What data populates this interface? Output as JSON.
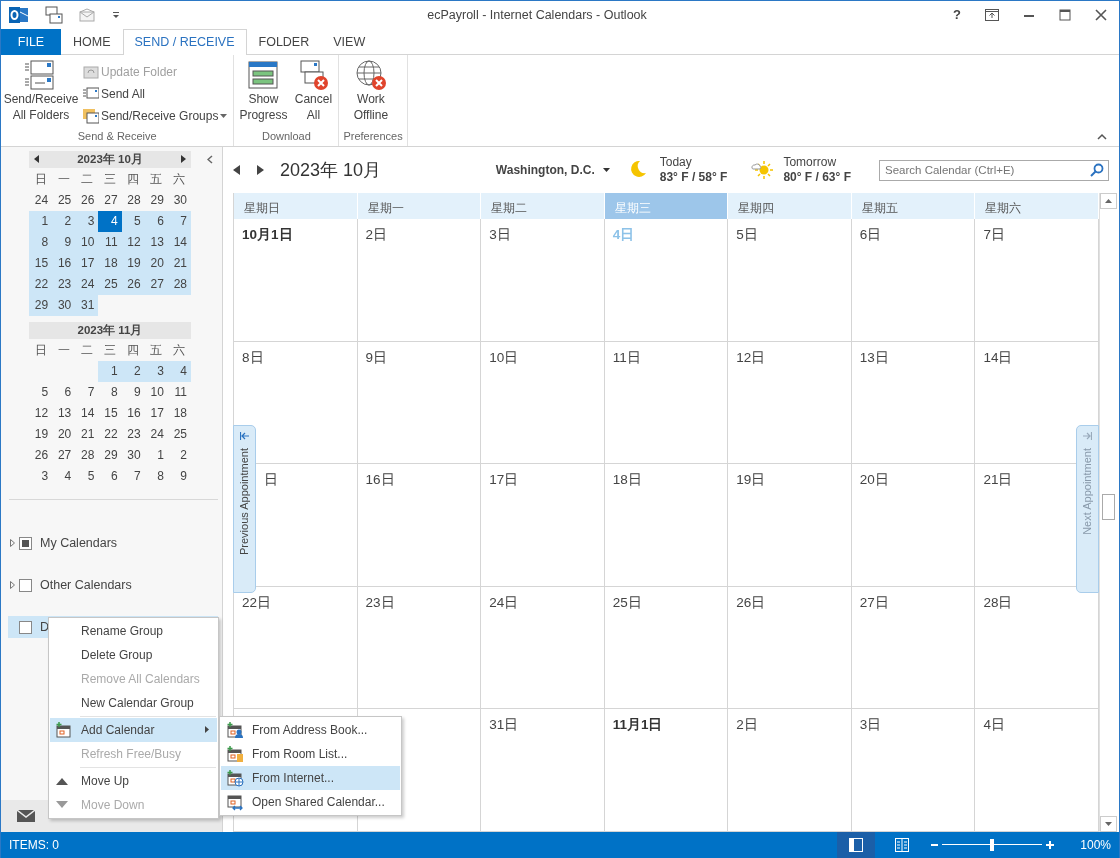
{
  "title_bar": {
    "title": "ecPayroll - Internet Calendars - Outlook",
    "help": "?"
  },
  "ribbon_tabs": [
    {
      "label": "FILE",
      "kind": "file",
      "selected": false
    },
    {
      "label": "HOME",
      "kind": "tab",
      "selected": false
    },
    {
      "label": "SEND / RECEIVE",
      "kind": "tab",
      "selected": true
    },
    {
      "label": "FOLDER",
      "kind": "tab",
      "selected": false
    },
    {
      "label": "VIEW",
      "kind": "tab",
      "selected": false
    }
  ],
  "ribbon_groups": [
    {
      "name": "Send & Receive",
      "buttons": [
        {
          "label": "Send/Receive All Folders",
          "kind": "large",
          "disabled": false
        },
        {
          "label": "Update Folder",
          "kind": "small",
          "disabled": true
        },
        {
          "label": "Send All",
          "kind": "small",
          "disabled": false
        },
        {
          "label": "Send/Receive Groups",
          "kind": "small-dropdown",
          "disabled": false
        }
      ]
    },
    {
      "name": "Download",
      "buttons": [
        {
          "label": "Show Progress",
          "kind": "large",
          "disabled": false
        },
        {
          "label": "Cancel All",
          "kind": "large",
          "disabled": false
        }
      ]
    },
    {
      "name": "Preferences",
      "buttons": [
        {
          "label": "Work Offline",
          "kind": "large",
          "disabled": false
        }
      ]
    }
  ],
  "navigation": {
    "mini_calendars": [
      {
        "title": "2023年 10月",
        "arrows": true,
        "weekdays": [
          "日",
          "一",
          "二",
          "三",
          "四",
          "五",
          "六"
        ],
        "weeks": [
          [
            {
              "text": "24",
              "kind": "plain"
            },
            {
              "text": "25",
              "kind": "plain"
            },
            {
              "text": "26",
              "kind": "plain"
            },
            {
              "text": "27",
              "kind": "plain"
            },
            {
              "text": "28",
              "kind": "plain"
            },
            {
              "text": "29",
              "kind": "plain"
            },
            {
              "text": "30",
              "kind": "plain"
            }
          ],
          [
            {
              "text": "1",
              "kind": "range"
            },
            {
              "text": "2",
              "kind": "range"
            },
            {
              "text": "3",
              "kind": "range"
            },
            {
              "text": "4",
              "kind": "today"
            },
            {
              "text": "5",
              "kind": "range"
            },
            {
              "text": "6",
              "kind": "range"
            },
            {
              "text": "7",
              "kind": "range"
            }
          ],
          [
            {
              "text": "8",
              "kind": "range"
            },
            {
              "text": "9",
              "kind": "range"
            },
            {
              "text": "10",
              "kind": "range"
            },
            {
              "text": "11",
              "kind": "range"
            },
            {
              "text": "12",
              "kind": "range"
            },
            {
              "text": "13",
              "kind": "range"
            },
            {
              "text": "14",
              "kind": "range"
            }
          ],
          [
            {
              "text": "15",
              "kind": "range"
            },
            {
              "text": "16",
              "kind": "range"
            },
            {
              "text": "17",
              "kind": "range"
            },
            {
              "text": "18",
              "kind": "range"
            },
            {
              "text": "19",
              "kind": "range"
            },
            {
              "text": "20",
              "kind": "range"
            },
            {
              "text": "21",
              "kind": "range"
            }
          ],
          [
            {
              "text": "22",
              "kind": "range"
            },
            {
              "text": "23",
              "kind": "range"
            },
            {
              "text": "24",
              "kind": "range"
            },
            {
              "text": "25",
              "kind": "range"
            },
            {
              "text": "26",
              "kind": "range"
            },
            {
              "text": "27",
              "kind": "range"
            },
            {
              "text": "28",
              "kind": "range"
            }
          ],
          [
            {
              "text": "29",
              "kind": "range"
            },
            {
              "text": "30",
              "kind": "range"
            },
            {
              "text": "31",
              "kind": "range"
            }
          ]
        ]
      },
      {
        "title": "2023年 11月",
        "arrows": false,
        "weekdays": [
          "日",
          "一",
          "二",
          "三",
          "四",
          "五",
          "六"
        ],
        "weeks": [
          [
            {
              "kind": "plain"
            },
            {
              "kind": "plain"
            },
            {
              "kind": "plain"
            },
            {
              "text": "1",
              "kind": "range"
            },
            {
              "text": "2",
              "kind": "range"
            },
            {
              "text": "3",
              "kind": "range"
            },
            {
              "text": "4",
              "kind": "range"
            }
          ],
          [
            {
              "text": "5",
              "kind": "plain"
            },
            {
              "text": "6",
              "kind": "plain"
            },
            {
              "text": "7",
              "kind": "plain"
            },
            {
              "text": "8",
              "kind": "plain"
            },
            {
              "text": "9",
              "kind": "plain"
            },
            {
              "text": "10",
              "kind": "plain"
            },
            {
              "text": "11",
              "kind": "plain"
            }
          ],
          [
            {
              "text": "12",
              "kind": "plain"
            },
            {
              "text": "13",
              "kind": "plain"
            },
            {
              "text": "14",
              "kind": "plain"
            },
            {
              "text": "15",
              "kind": "plain"
            },
            {
              "text": "16",
              "kind": "plain"
            },
            {
              "text": "17",
              "kind": "plain"
            },
            {
              "text": "18",
              "kind": "plain"
            }
          ],
          [
            {
              "text": "19",
              "kind": "plain"
            },
            {
              "text": "20",
              "kind": "plain"
            },
            {
              "text": "21",
              "kind": "plain"
            },
            {
              "text": "22",
              "kind": "plain"
            },
            {
              "text": "23",
              "kind": "plain"
            },
            {
              "text": "24",
              "kind": "plain"
            },
            {
              "text": "25",
              "kind": "plain"
            }
          ],
          [
            {
              "text": "26",
              "kind": "plain"
            },
            {
              "text": "27",
              "kind": "plain"
            },
            {
              "text": "28",
              "kind": "plain"
            },
            {
              "text": "29",
              "kind": "plain"
            },
            {
              "text": "30",
              "kind": "plain"
            },
            {
              "text": "1",
              "kind": "plain"
            },
            {
              "text": "2",
              "kind": "plain"
            }
          ],
          [
            {
              "text": "3",
              "kind": "plain"
            },
            {
              "text": "4",
              "kind": "plain"
            },
            {
              "text": "5",
              "kind": "plain"
            },
            {
              "text": "6",
              "kind": "plain"
            },
            {
              "text": "7",
              "kind": "plain"
            },
            {
              "text": "8",
              "kind": "plain"
            },
            {
              "text": "9",
              "kind": "plain"
            }
          ]
        ]
      }
    ],
    "folders": [
      {
        "label": "My Calendars",
        "checked": true,
        "selected": false
      },
      {
        "label": "Other Calendars",
        "checked": false,
        "selected": false
      },
      {
        "label": "D",
        "checked": false,
        "selected": true
      }
    ]
  },
  "calendar": {
    "title": "2023年 10月",
    "location": "Washington, D.C.",
    "weather": [
      {
        "day": "Today",
        "temps": "83° F / 58° F",
        "kind": "night"
      },
      {
        "day": "Tomorrow",
        "temps": "80° F / 63° F",
        "kind": "sunny"
      }
    ],
    "search": {
      "placeholder": "Search Calendar (Ctrl+E)"
    },
    "weekdays": [
      {
        "label": "星期日",
        "selected": false
      },
      {
        "label": "星期一",
        "selected": false
      },
      {
        "label": "星期二",
        "selected": false
      },
      {
        "label": "星期三",
        "selected": true
      },
      {
        "label": "星期四",
        "selected": false
      },
      {
        "label": "星期五",
        "selected": false
      },
      {
        "label": "星期六",
        "selected": false
      }
    ],
    "weeks": [
      [
        {
          "text": "10月1日",
          "kind": "month-start"
        },
        {
          "text": "2日",
          "kind": "day"
        },
        {
          "text": "3日",
          "kind": "day"
        },
        {
          "text": "4日",
          "kind": "today"
        },
        {
          "text": "5日",
          "kind": "day"
        },
        {
          "text": "6日",
          "kind": "day"
        },
        {
          "text": "7日",
          "kind": "day"
        }
      ],
      [
        {
          "text": "8日",
          "kind": "day"
        },
        {
          "text": "9日",
          "kind": "day"
        },
        {
          "text": "10日",
          "kind": "day"
        },
        {
          "text": "11日",
          "kind": "day"
        },
        {
          "text": "12日",
          "kind": "day"
        },
        {
          "text": "13日",
          "kind": "day"
        },
        {
          "text": "14日",
          "kind": "day"
        }
      ],
      [
        {
          "text": "日",
          "kind": "covered"
        },
        {
          "text": "16日",
          "kind": "day"
        },
        {
          "text": "17日",
          "kind": "day"
        },
        {
          "text": "18日",
          "kind": "day"
        },
        {
          "text": "19日",
          "kind": "day"
        },
        {
          "text": "20日",
          "kind": "day"
        },
        {
          "text": "21日",
          "kind": "day"
        }
      ],
      [
        {
          "text": "22日",
          "kind": "day"
        },
        {
          "text": "23日",
          "kind": "day"
        },
        {
          "text": "24日",
          "kind": "day"
        },
        {
          "text": "25日",
          "kind": "day"
        },
        {
          "text": "26日",
          "kind": "day"
        },
        {
          "text": "27日",
          "kind": "day"
        },
        {
          "text": "28日",
          "kind": "day"
        }
      ],
      [
        {
          "kind": "day"
        },
        {
          "kind": "day"
        },
        {
          "text": "31日",
          "kind": "day"
        },
        {
          "text": "11月1日",
          "kind": "month-start"
        },
        {
          "text": "2日",
          "kind": "day"
        },
        {
          "text": "3日",
          "kind": "day"
        },
        {
          "text": "4日",
          "kind": "day"
        }
      ]
    ],
    "previous_appointment": "Previous Appointment",
    "next_appointment": "Next Appointment"
  },
  "context_menu": {
    "items": [
      {
        "label": "Rename Group",
        "kind": "plain",
        "disabled": false,
        "selected": false
      },
      {
        "label": "Delete Group",
        "kind": "plain",
        "disabled": false,
        "selected": false
      },
      {
        "label": "Remove All Calendars",
        "kind": "plain",
        "disabled": true,
        "selected": false
      },
      {
        "label": "New Calendar Group",
        "kind": "plain",
        "disabled": false,
        "selected": false
      },
      {
        "kind": "separator"
      },
      {
        "label": "Add Calendar",
        "kind": "submenu",
        "disabled": false,
        "selected": true
      },
      {
        "label": "Refresh Free/Busy",
        "kind": "plain",
        "disabled": true,
        "selected": false
      },
      {
        "kind": "separator"
      },
      {
        "label": "Move Up",
        "kind": "move-up",
        "disabled": false,
        "selected": false
      },
      {
        "label": "Move Down",
        "kind": "move-down",
        "disabled": true,
        "selected": false
      }
    ]
  },
  "submenu": {
    "items": [
      {
        "label": "From Address Book...",
        "kind": "address-book",
        "selected": false
      },
      {
        "label": "From Room List...",
        "kind": "room-list",
        "selected": false
      },
      {
        "label": "From Internet...",
        "kind": "internet",
        "selected": true
      },
      {
        "label": "Open Shared Calendar...",
        "kind": "shared",
        "selected": false
      }
    ]
  },
  "status_bar": {
    "items": "ITEMS: 0",
    "zoom": {
      "level": 0.5,
      "reading": "100%"
    }
  }
}
